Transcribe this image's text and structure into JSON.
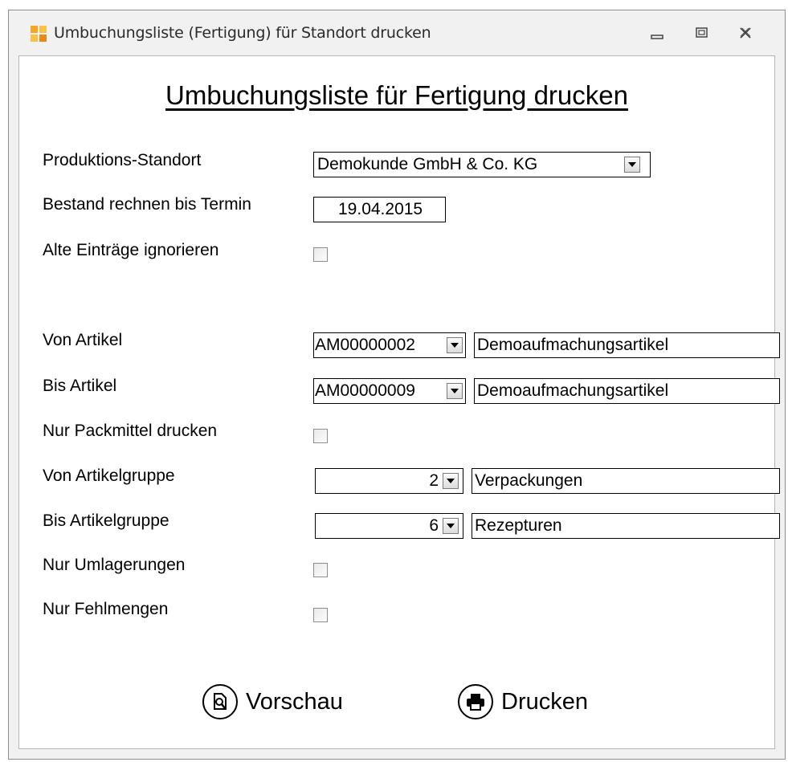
{
  "window": {
    "title": "Umbuchungsliste (Fertigung) für Standort drucken",
    "icon": "app-icon"
  },
  "form": {
    "heading": "Umbuchungsliste für Fertigung drucken",
    "produktions_standort": {
      "label": "Produktions-Standort",
      "value": "Demokunde GmbH & Co. KG"
    },
    "bestand_termin": {
      "label": "Bestand rechnen bis Termin",
      "value": "19.04.2015"
    },
    "alte_eintraege": {
      "label": "Alte Einträge ignorieren",
      "checked": false
    },
    "von_artikel": {
      "label": "Von Artikel",
      "code": "AM00000002",
      "description": "Demoaufmachungsartikel"
    },
    "bis_artikel": {
      "label": "Bis Artikel",
      "code": "AM00000009",
      "description": "Demoaufmachungsartikel"
    },
    "nur_packmittel": {
      "label": "Nur Packmittel drucken",
      "checked": false
    },
    "von_artikelgruppe": {
      "label": "Von Artikelgruppe",
      "code": "2",
      "description": "Verpackungen"
    },
    "bis_artikelgruppe": {
      "label": "Bis Artikelgruppe",
      "code": "6",
      "description": "Rezepturen"
    },
    "nur_umlagerungen": {
      "label": "Nur Umlagerungen",
      "checked": false
    },
    "nur_fehlmengen": {
      "label": "Nur Fehlmengen",
      "checked": false
    }
  },
  "actions": {
    "preview": {
      "label": "Vorschau",
      "icon": "preview-icon"
    },
    "print": {
      "label": "Drucken",
      "icon": "printer-icon"
    }
  }
}
